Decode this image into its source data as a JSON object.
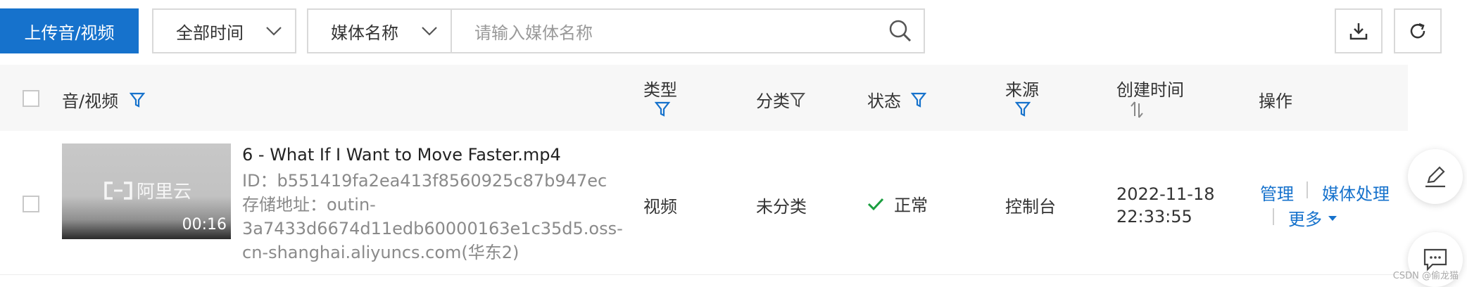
{
  "toolbar": {
    "upload_label": "上传音/视频",
    "time_filter": "全部时间",
    "search_field": "媒体名称",
    "search_placeholder": "请输入媒体名称"
  },
  "table": {
    "headers": {
      "media": "音/视频",
      "type": "类型",
      "category": "分类",
      "status": "状态",
      "source": "来源",
      "created": "创建时间",
      "actions": "操作"
    },
    "rows": [
      {
        "thumb_logo": "阿里云",
        "duration": "00:16",
        "title": "6 - What If I Want to Move Faster.mp4",
        "id_line": "ID：b551419fa2ea413f8560925c87b947ec",
        "storage_line1": "存储地址：outin-",
        "storage_line2": "3a7433d6674d11edb60000163e1c35d5.oss-",
        "storage_line3": "cn-shanghai.aliyuncs.com(华东2)",
        "type": "视频",
        "category": "未分类",
        "status": "正常",
        "source": "控制台",
        "created_date": "2022-11-18",
        "created_time": "22:33:55",
        "action_manage": "管理",
        "action_process": "媒体处理",
        "action_more": "更多"
      }
    ]
  },
  "watermark": "CSDN @偷龙猫",
  "colors": {
    "primary": "#1672cc",
    "status_ok": "#1a9e3f"
  }
}
